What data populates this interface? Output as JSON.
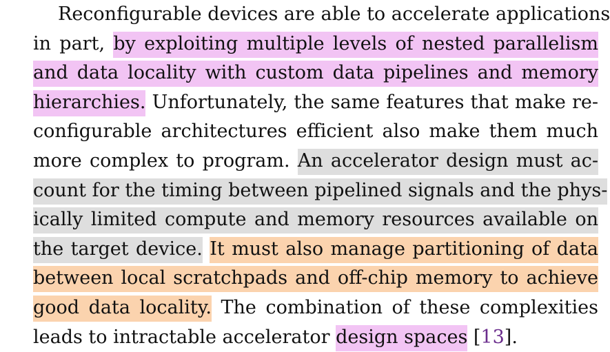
{
  "paragraph": {
    "lines": [
      [
        {
          "t": "Reconfigurable devices are able to accelerate applications,",
          "h": ""
        }
      ],
      [
        {
          "t": "in part, ",
          "h": ""
        },
        {
          "t": "by exploiting multiple levels of nested parallelism",
          "h": "pink"
        }
      ],
      [
        {
          "t": "and data locality with custom data pipelines and memory",
          "h": "pink"
        }
      ],
      [
        {
          "t": "hierarchies.",
          "h": "pink"
        },
        {
          "t": " Unfortunately, the same features that make re-",
          "h": ""
        }
      ],
      [
        {
          "t": "configurable architectures efficient also make them much",
          "h": ""
        }
      ],
      [
        {
          "t": "more complex to program. ",
          "h": ""
        },
        {
          "t": "An accelerator design must ac-",
          "h": "gray"
        }
      ],
      [
        {
          "t": "count for the timing between pipelined signals and the phys-",
          "h": "gray"
        }
      ],
      [
        {
          "t": "ically limited compute and memory resources available on",
          "h": "gray"
        }
      ],
      [
        {
          "t": "the target device.",
          "h": "gray"
        },
        {
          "t": " ",
          "h": ""
        },
        {
          "t": "It must also manage partitioning of data",
          "h": "orange"
        }
      ],
      [
        {
          "t": "between local scratchpads and off-chip memory to achieve",
          "h": "orange"
        }
      ],
      [
        {
          "t": "good data locality.",
          "h": "orange"
        },
        {
          "t": " The combination of these complexities",
          "h": ""
        }
      ],
      [
        {
          "t": "leads to intractable accelerator ",
          "h": ""
        },
        {
          "t": "design spaces",
          "h": "pink"
        },
        {
          "t": " [",
          "h": ""
        },
        {
          "t": "13",
          "h": "cite"
        },
        {
          "t": "].",
          "h": ""
        }
      ]
    ]
  },
  "colors": {
    "highlight_pink": "#f2c4f4",
    "highlight_gray": "#dedede",
    "highlight_orange": "#fbd3ae",
    "citation": "#6a2c8c",
    "text": "#111111"
  }
}
